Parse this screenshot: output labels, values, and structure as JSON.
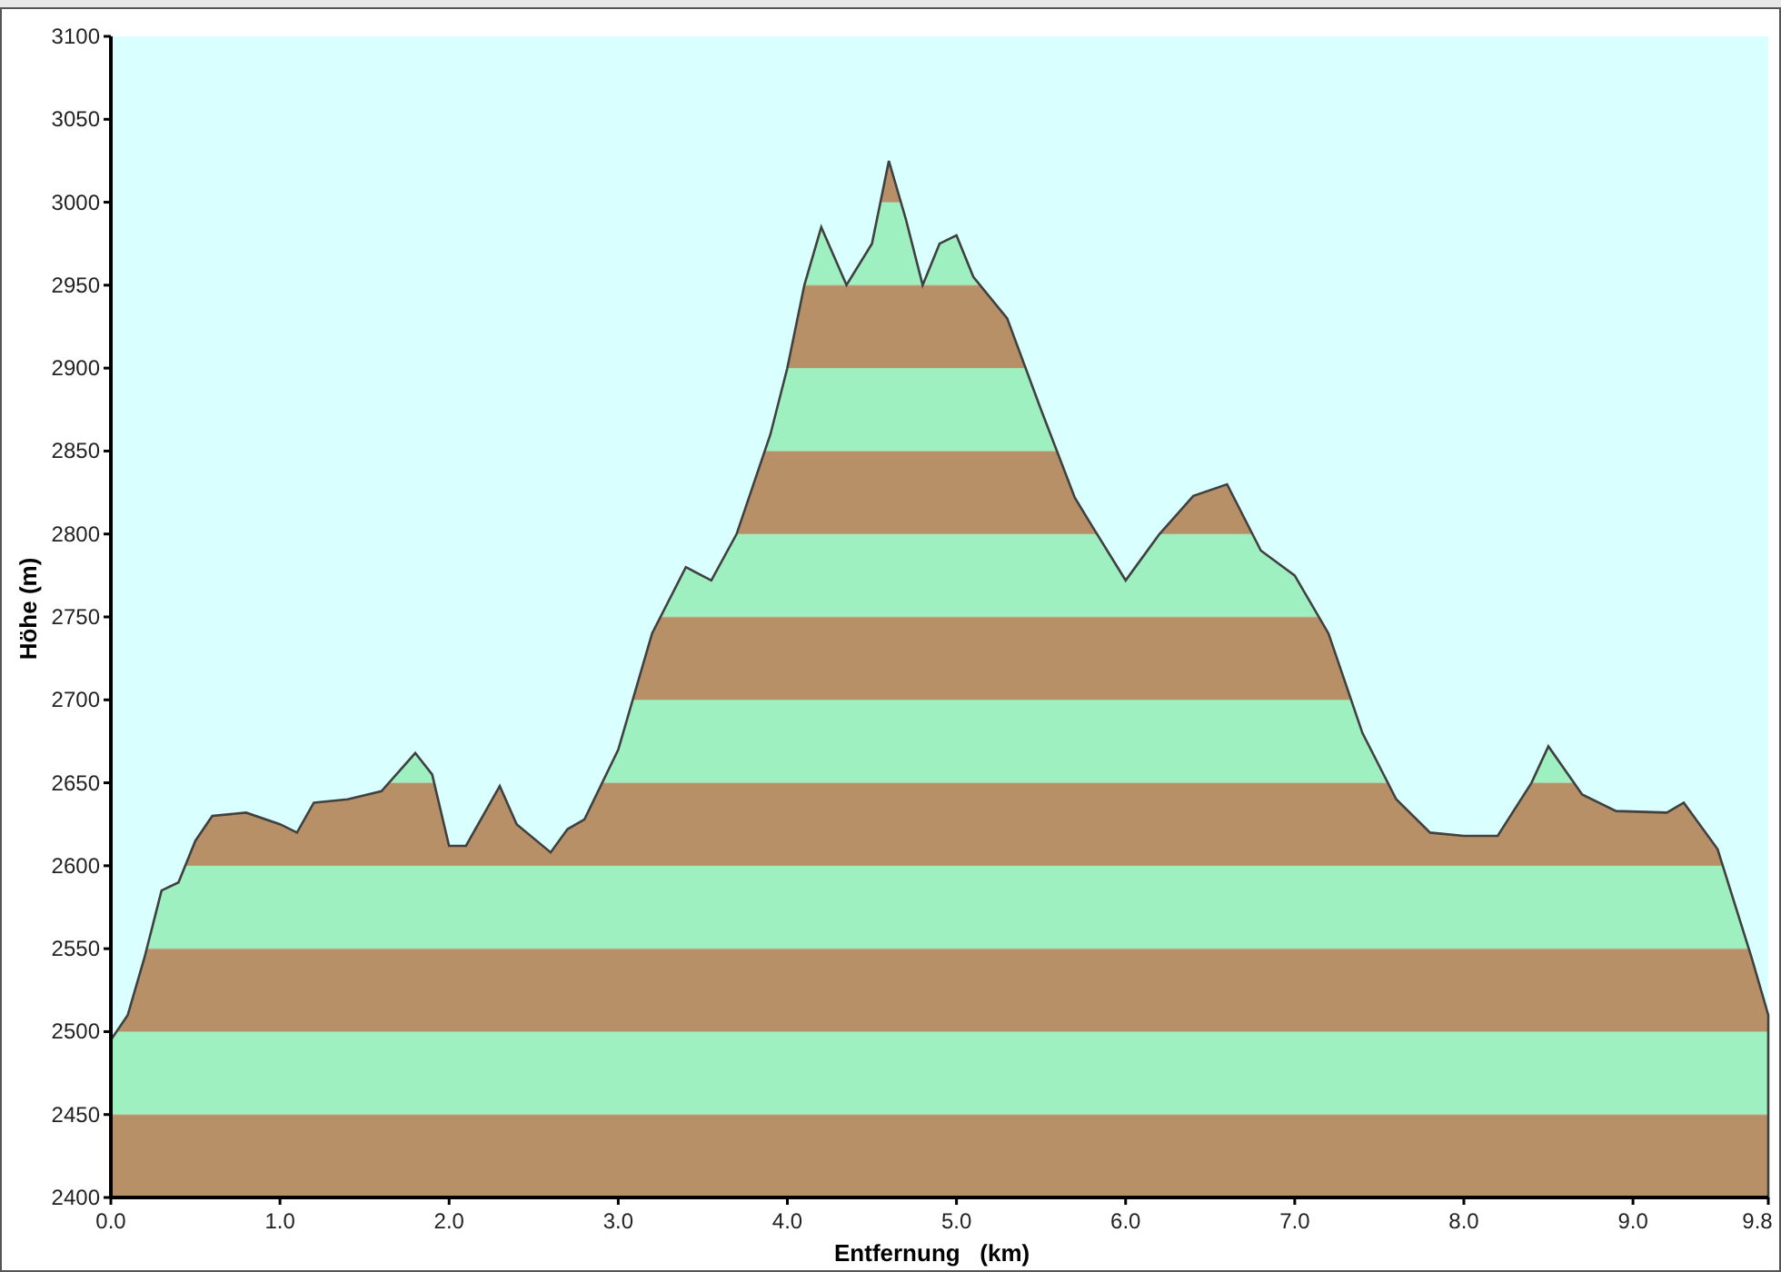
{
  "chart_data": {
    "type": "area",
    "xlabel": "Entfernung   (km)",
    "ylabel": "Höhe (m)",
    "x": [
      0,
      0.1,
      0.2,
      0.3,
      0.4,
      0.5,
      0.6,
      0.8,
      1.0,
      1.1,
      1.2,
      1.4,
      1.6,
      1.8,
      1.9,
      2.0,
      2.1,
      2.3,
      2.4,
      2.6,
      2.7,
      2.8,
      3.0,
      3.2,
      3.4,
      3.55,
      3.7,
      3.9,
      4.0,
      4.1,
      4.2,
      4.35,
      4.5,
      4.6,
      4.7,
      4.8,
      4.9,
      5.0,
      5.1,
      5.3,
      5.5,
      5.7,
      5.8,
      6.0,
      6.2,
      6.4,
      6.6,
      6.8,
      7.0,
      7.2,
      7.4,
      7.6,
      7.8,
      8.0,
      8.2,
      8.4,
      8.5,
      8.7,
      8.9,
      9.2,
      9.3,
      9.5,
      9.7,
      9.8
    ],
    "series": [
      {
        "color": "#404040",
        "values": [
          2495,
          2510,
          2545,
          2585,
          2590,
          2615,
          2630,
          2632,
          2625,
          2620,
          2638,
          2640,
          2645,
          2668,
          2655,
          2612,
          2612,
          2648,
          2625,
          2608,
          2622,
          2628,
          2670,
          2740,
          2780,
          2772,
          2800,
          2860,
          2900,
          2950,
          2985,
          2950,
          2975,
          3025,
          2990,
          2950,
          2975,
          2980,
          2955,
          2930,
          2875,
          2822,
          2805,
          2772,
          2800,
          2823,
          2830,
          2790,
          2775,
          2740,
          2680,
          2640,
          2620,
          2618,
          2618,
          2650,
          2672,
          2643,
          2633,
          2632,
          2638,
          2610,
          2545,
          2510
        ]
      }
    ],
    "xlim": [
      0,
      9.8
    ],
    "ylim": [
      2400,
      3100
    ],
    "xticks": [
      {
        "value": 0,
        "label": "0.0"
      },
      {
        "value": 1,
        "label": "1.0"
      },
      {
        "value": 2,
        "label": "2.0"
      },
      {
        "value": 3,
        "label": "3.0"
      },
      {
        "value": 4,
        "label": "4.0"
      },
      {
        "value": 5,
        "label": "5.0"
      },
      {
        "value": 6,
        "label": "6.0"
      },
      {
        "value": 7,
        "label": "7.0"
      },
      {
        "value": 8,
        "label": "8.0"
      },
      {
        "value": 9,
        "label": "9.0"
      },
      {
        "value": 9.8,
        "label": "9.8"
      }
    ],
    "yticks": [
      2400,
      2450,
      2500,
      2550,
      2600,
      2650,
      2700,
      2750,
      2800,
      2850,
      2900,
      2950,
      3000,
      3050,
      3100
    ]
  }
}
